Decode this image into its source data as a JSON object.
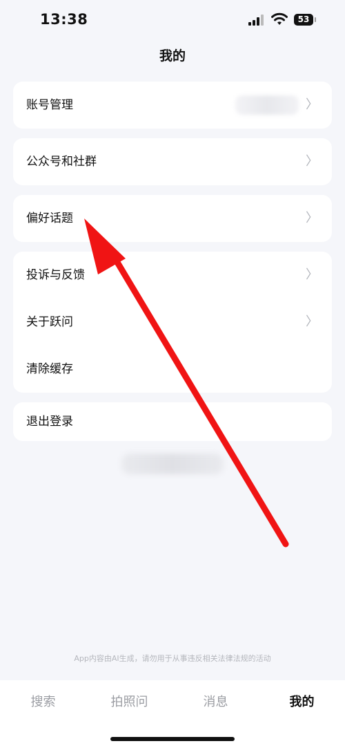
{
  "status_bar": {
    "time": "13:38",
    "battery": "53"
  },
  "header": {
    "title": "我的"
  },
  "sections": [
    {
      "items": [
        {
          "label": "账号管理",
          "chevron": "〉"
        }
      ]
    },
    {
      "items": [
        {
          "label": "公众号和社群",
          "chevron": "〉"
        }
      ]
    },
    {
      "items": [
        {
          "label": "偏好话题",
          "chevron": "〉"
        }
      ]
    },
    {
      "items": [
        {
          "label": "投诉与反馈",
          "chevron": "〉"
        },
        {
          "label": "关于跃问",
          "chevron": "〉"
        },
        {
          "label": "清除缓存"
        }
      ]
    },
    {
      "items": [
        {
          "label": "退出登录"
        }
      ]
    }
  ],
  "disclaimer": "App内容由AI生成，请勿用于从事违反相关法律法规的活动",
  "tabbar": {
    "tabs": [
      {
        "label": "搜索"
      },
      {
        "label": "拍照问"
      },
      {
        "label": "消息"
      },
      {
        "label": "我的"
      }
    ],
    "active_label": "我的"
  },
  "annotation": {
    "type": "red-arrow",
    "color": "#f01414",
    "points_to": "偏好话题"
  }
}
